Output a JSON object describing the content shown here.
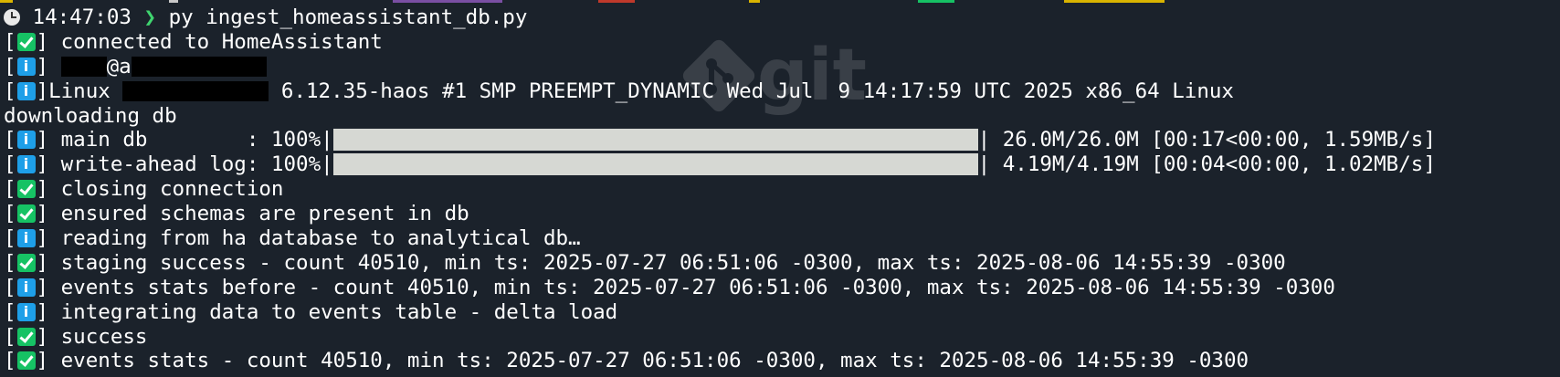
{
  "colors": {
    "background": "#1b222b",
    "success_badge": "#16c264",
    "info_badge": "#1e9fe8",
    "prompt_chevron": "#3fd46f",
    "progress_fill": "#d6d8d3",
    "redaction": "#000000"
  },
  "watermark": {
    "text": "git"
  },
  "prompt": {
    "time": "14:47:03",
    "chevron": "❯",
    "command": "py ingest_homeassistant_db.py"
  },
  "lines": [
    {
      "status": "ok",
      "text": "connected to HomeAssistant"
    },
    {
      "status": "info",
      "text_after_redaction": "@a"
    },
    {
      "status": "info",
      "prefix": "Linux",
      "suffix": "6.12.35-haos #1 SMP PREEMPT_DYNAMIC Wed Jul  9 14:17:59 UTC 2025 x86_64 Linux"
    },
    {
      "status": null,
      "text": "downloading db"
    },
    {
      "status": "info",
      "label": "main db        : 100%|",
      "progress": 1.0,
      "stats": "| 26.0M/26.0M [00:17<00:00, 1.59MB/s]"
    },
    {
      "status": "info",
      "label": "write-ahead log: 100%|",
      "progress": 1.0,
      "stats": "| 4.19M/4.19M [00:04<00:00, 1.02MB/s]"
    },
    {
      "status": "ok",
      "text": "closing connection"
    },
    {
      "status": "ok",
      "text": "ensured schemas are present in db"
    },
    {
      "status": "info",
      "text": "reading from ha database to analytical db…"
    },
    {
      "status": "ok",
      "text": "staging success - count 40510, min ts: 2025-07-27 06:51:06 -0300, max ts: 2025-08-06 14:55:39 -0300"
    },
    {
      "status": "info",
      "text": "events stats before - count 40510, min ts: 2025-07-27 06:51:06 -0300, max ts: 2025-08-06 14:55:39 -0300"
    },
    {
      "status": "info",
      "text": "integrating data to events table - delta load"
    },
    {
      "status": "ok",
      "text": "success"
    },
    {
      "status": "ok",
      "text": "events stats - count 40510, min ts: 2025-07-27 06:51:06 -0300, max ts: 2025-08-06 14:55:39 -0300"
    }
  ]
}
